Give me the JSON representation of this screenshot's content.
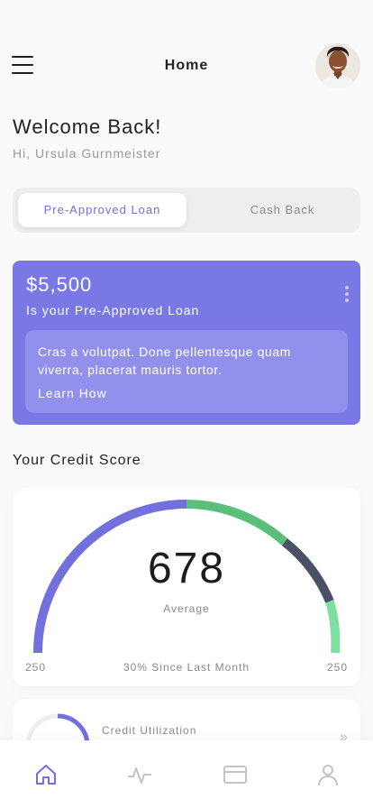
{
  "header": {
    "title": "Home"
  },
  "welcome": {
    "title": "Welcome Back!",
    "subtitle": "Hi, Ursula Gurnmeister"
  },
  "tabs": [
    {
      "label": "Pre-Approved Loan",
      "active": true
    },
    {
      "label": "Cash Back",
      "active": false
    }
  ],
  "loan_card": {
    "amount": "$5,500",
    "label": "Is your Pre-Approved Loan",
    "info": "Cras a volutpat. Done pellentesque quam viverra, placerat mauris tortor.",
    "link": "Learn How"
  },
  "credit": {
    "section_title": "Your Credit Score",
    "score": "678",
    "rating": "Average",
    "min": "250",
    "max": "250",
    "change": "30% Since Last Month"
  },
  "utilization": {
    "label": "Credit Utilization"
  },
  "nav": [
    {
      "icon": "home-icon",
      "active": true
    },
    {
      "icon": "activity-icon",
      "active": false
    },
    {
      "icon": "card-icon",
      "active": false
    },
    {
      "icon": "profile-icon",
      "active": false
    }
  ],
  "colors": {
    "accent": "#7978e4",
    "gauge_purple": "#7170dd",
    "gauge_green": "#5bbf7a",
    "gauge_slate": "#4a5066",
    "gauge_mint": "#7ee0a0"
  }
}
